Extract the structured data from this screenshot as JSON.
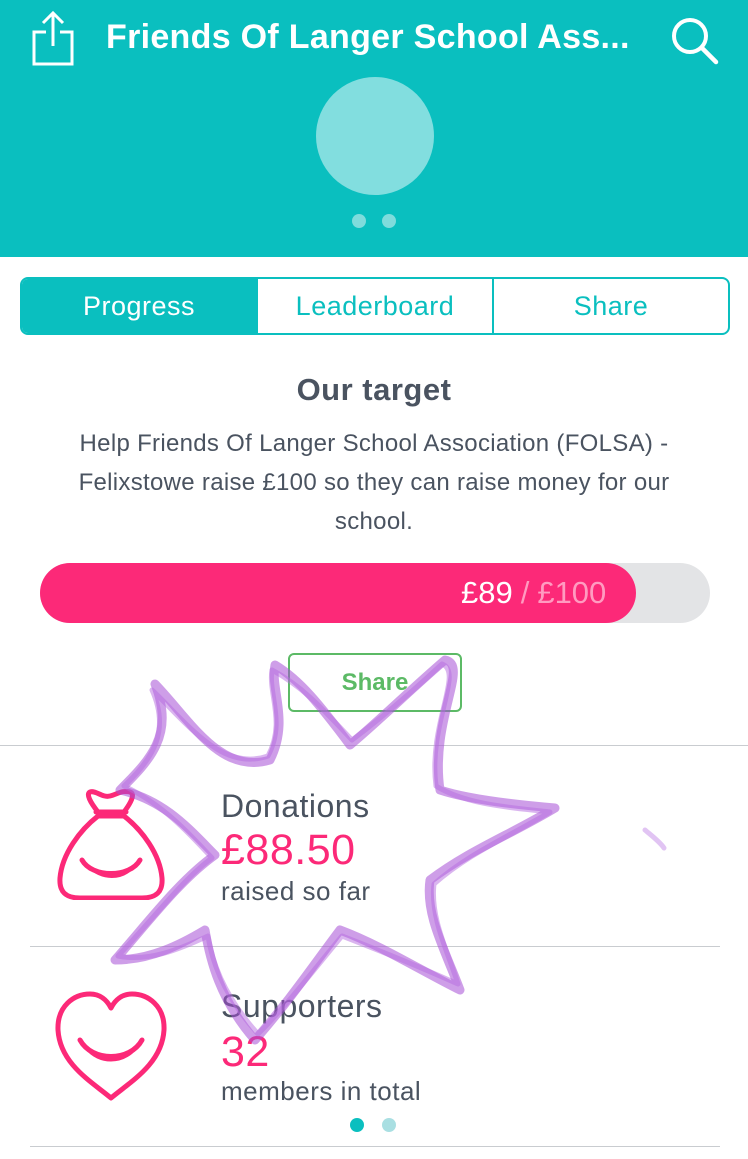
{
  "header": {
    "title": "Friends Of Langer School Ass...",
    "share_icon": "share-icon",
    "search_icon": "search-icon",
    "carousel_dots": 2
  },
  "tabs": [
    {
      "label": "Progress",
      "active": true
    },
    {
      "label": "Leaderboard",
      "active": false
    },
    {
      "label": "Share",
      "active": false
    }
  ],
  "target": {
    "title": "Our target",
    "description": "Help Friends Of Langer School Association (FOLSA) - Felixstowe raise £100 so they can raise money for our school.",
    "raised": "£89",
    "separator": "/",
    "goal": "£100",
    "progress_fraction": 0.89
  },
  "share_button": {
    "label": "Share"
  },
  "stats": {
    "donations": {
      "icon": "money-bag-icon",
      "label": "Donations",
      "value": "£88.50",
      "sub": "raised so far"
    },
    "supporters": {
      "icon": "heart-icon",
      "label": "Supporters",
      "value": "32",
      "sub": "members in total"
    }
  },
  "pager": {
    "pages": 2,
    "active": 0
  },
  "colors": {
    "brand": "#0abfbf",
    "accent": "#fc2978",
    "share_green": "#5cba66",
    "text": "#4a5360",
    "scribble": "#a64fd6"
  }
}
